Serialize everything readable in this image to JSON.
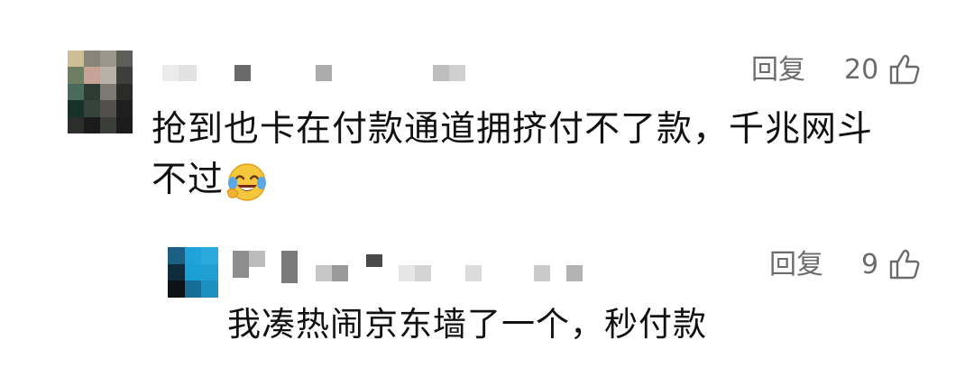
{
  "comments": [
    {
      "reply_label": "回复",
      "like_count": "20",
      "text_line1": "抢到也卡在付款通道拥挤付不了款，千兆网斗",
      "text_line2": "不过",
      "emoji_name": "face-with-tears-of-joy",
      "replies": [
        {
          "reply_label": "回复",
          "like_count": "9",
          "text": "我凑热闹京东墙了一个，秒付款"
        }
      ]
    }
  ],
  "colors": {
    "meta_gray": "#6b6b6b",
    "text": "#111111"
  }
}
